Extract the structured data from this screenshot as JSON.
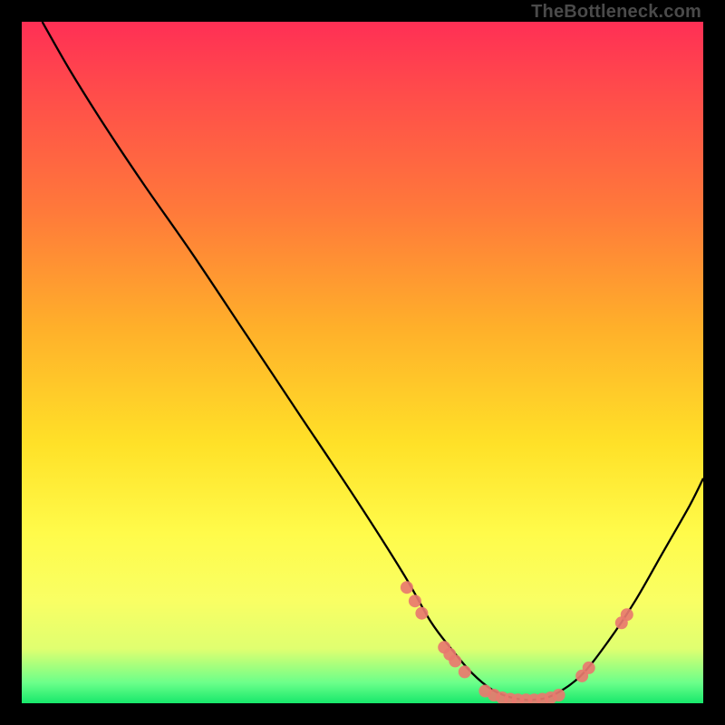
{
  "watermark": "TheBottleneck.com",
  "chart_data": {
    "type": "line",
    "title": "",
    "xlabel": "",
    "ylabel": "",
    "xlim": [
      0,
      100
    ],
    "ylim": [
      0,
      100
    ],
    "series": [
      {
        "name": "curve",
        "x": [
          3,
          7,
          12,
          18,
          25,
          33,
          41,
          49,
          56,
          60,
          63,
          66,
          69,
          72,
          75,
          78,
          82,
          86,
          90,
          94,
          98,
          100
        ],
        "y": [
          100,
          93,
          85,
          76,
          66,
          54,
          42,
          30,
          19,
          12,
          8,
          4.5,
          2,
          0.8,
          0.5,
          1.2,
          4,
          9,
          15,
          22,
          29,
          33
        ]
      }
    ],
    "markers": [
      {
        "x": 56.5,
        "y": 17.0
      },
      {
        "x": 57.7,
        "y": 15.0
      },
      {
        "x": 58.7,
        "y": 13.2
      },
      {
        "x": 62.0,
        "y": 8.2
      },
      {
        "x": 62.8,
        "y": 7.2
      },
      {
        "x": 63.6,
        "y": 6.2
      },
      {
        "x": 65.0,
        "y": 4.6
      },
      {
        "x": 68.0,
        "y": 1.8
      },
      {
        "x": 69.3,
        "y": 1.2
      },
      {
        "x": 70.5,
        "y": 0.8
      },
      {
        "x": 71.7,
        "y": 0.6
      },
      {
        "x": 72.8,
        "y": 0.5
      },
      {
        "x": 74.0,
        "y": 0.5
      },
      {
        "x": 75.2,
        "y": 0.5
      },
      {
        "x": 76.4,
        "y": 0.6
      },
      {
        "x": 77.6,
        "y": 0.8
      },
      {
        "x": 78.8,
        "y": 1.2
      },
      {
        "x": 82.2,
        "y": 4.0
      },
      {
        "x": 83.2,
        "y": 5.2
      },
      {
        "x": 88.0,
        "y": 11.8
      },
      {
        "x": 88.8,
        "y": 13.0
      }
    ],
    "gradient_stops": [
      {
        "pos": 0.0,
        "color": "#ff2f55"
      },
      {
        "pos": 0.28,
        "color": "#ff7a3a"
      },
      {
        "pos": 0.62,
        "color": "#ffe128"
      },
      {
        "pos": 0.92,
        "color": "#e0ff70"
      },
      {
        "pos": 1.0,
        "color": "#17e86b"
      }
    ]
  }
}
